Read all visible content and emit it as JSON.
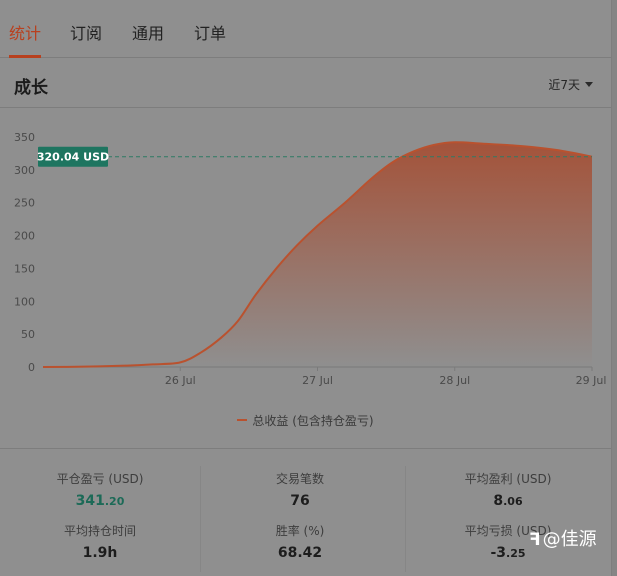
{
  "tabs": [
    "统计",
    "订阅",
    "通用",
    "订单"
  ],
  "section": {
    "title": "成长",
    "range": "近7天"
  },
  "chart_data": {
    "type": "area",
    "ylim": [
      0,
      350
    ],
    "yticks": [
      0,
      50,
      100,
      150,
      200,
      250,
      300,
      350
    ],
    "xticks": [
      {
        "label": "26 Jul",
        "x": 1
      },
      {
        "label": "27 Jul",
        "x": 2
      },
      {
        "label": "28 Jul",
        "x": 3
      },
      {
        "label": "29 Jul",
        "x": 4
      }
    ],
    "xlim": [
      0,
      4
    ],
    "series": [
      {
        "name": "总收益 (包含持仓盈亏)",
        "points": [
          [
            0,
            0
          ],
          [
            0.3,
            0.5
          ],
          [
            0.6,
            2
          ],
          [
            0.8,
            4
          ],
          [
            1.0,
            7
          ],
          [
            1.15,
            22
          ],
          [
            1.3,
            45
          ],
          [
            1.42,
            70
          ],
          [
            1.55,
            110
          ],
          [
            1.7,
            150
          ],
          [
            1.85,
            185
          ],
          [
            2.0,
            215
          ],
          [
            2.2,
            250
          ],
          [
            2.4,
            288
          ],
          [
            2.55,
            312
          ],
          [
            2.7,
            328
          ],
          [
            2.85,
            338
          ],
          [
            3.0,
            342
          ],
          [
            3.2,
            340
          ],
          [
            3.5,
            336
          ],
          [
            3.75,
            330
          ],
          [
            4.0,
            320
          ]
        ]
      }
    ],
    "reference": {
      "value": 320.04,
      "label": "320.04 USD"
    },
    "colors": {
      "line": "#b9522f",
      "fill_top": "#a4533a",
      "ref_line": "#2f7a64",
      "ref_badge": "#1e7560"
    }
  },
  "stats": [
    {
      "label": "平仓盈亏 (USD)",
      "int": "341",
      "dec": ".20",
      "green": true
    },
    {
      "label": "交易笔数",
      "int": "76",
      "dec": ""
    },
    {
      "label": "平均盈利 (USD)",
      "int": "8",
      "dec": ".06"
    },
    {
      "label": "平均持仓时间",
      "int": "1.9h",
      "dec": ""
    },
    {
      "label": "胜率 (%)",
      "int": "68.42",
      "dec": ""
    },
    {
      "label": "平均亏损 (USD)",
      "int": "-3",
      "dec": ".25"
    }
  ],
  "watermark": {
    "logo": "ꟻ",
    "text": "@佳源"
  }
}
